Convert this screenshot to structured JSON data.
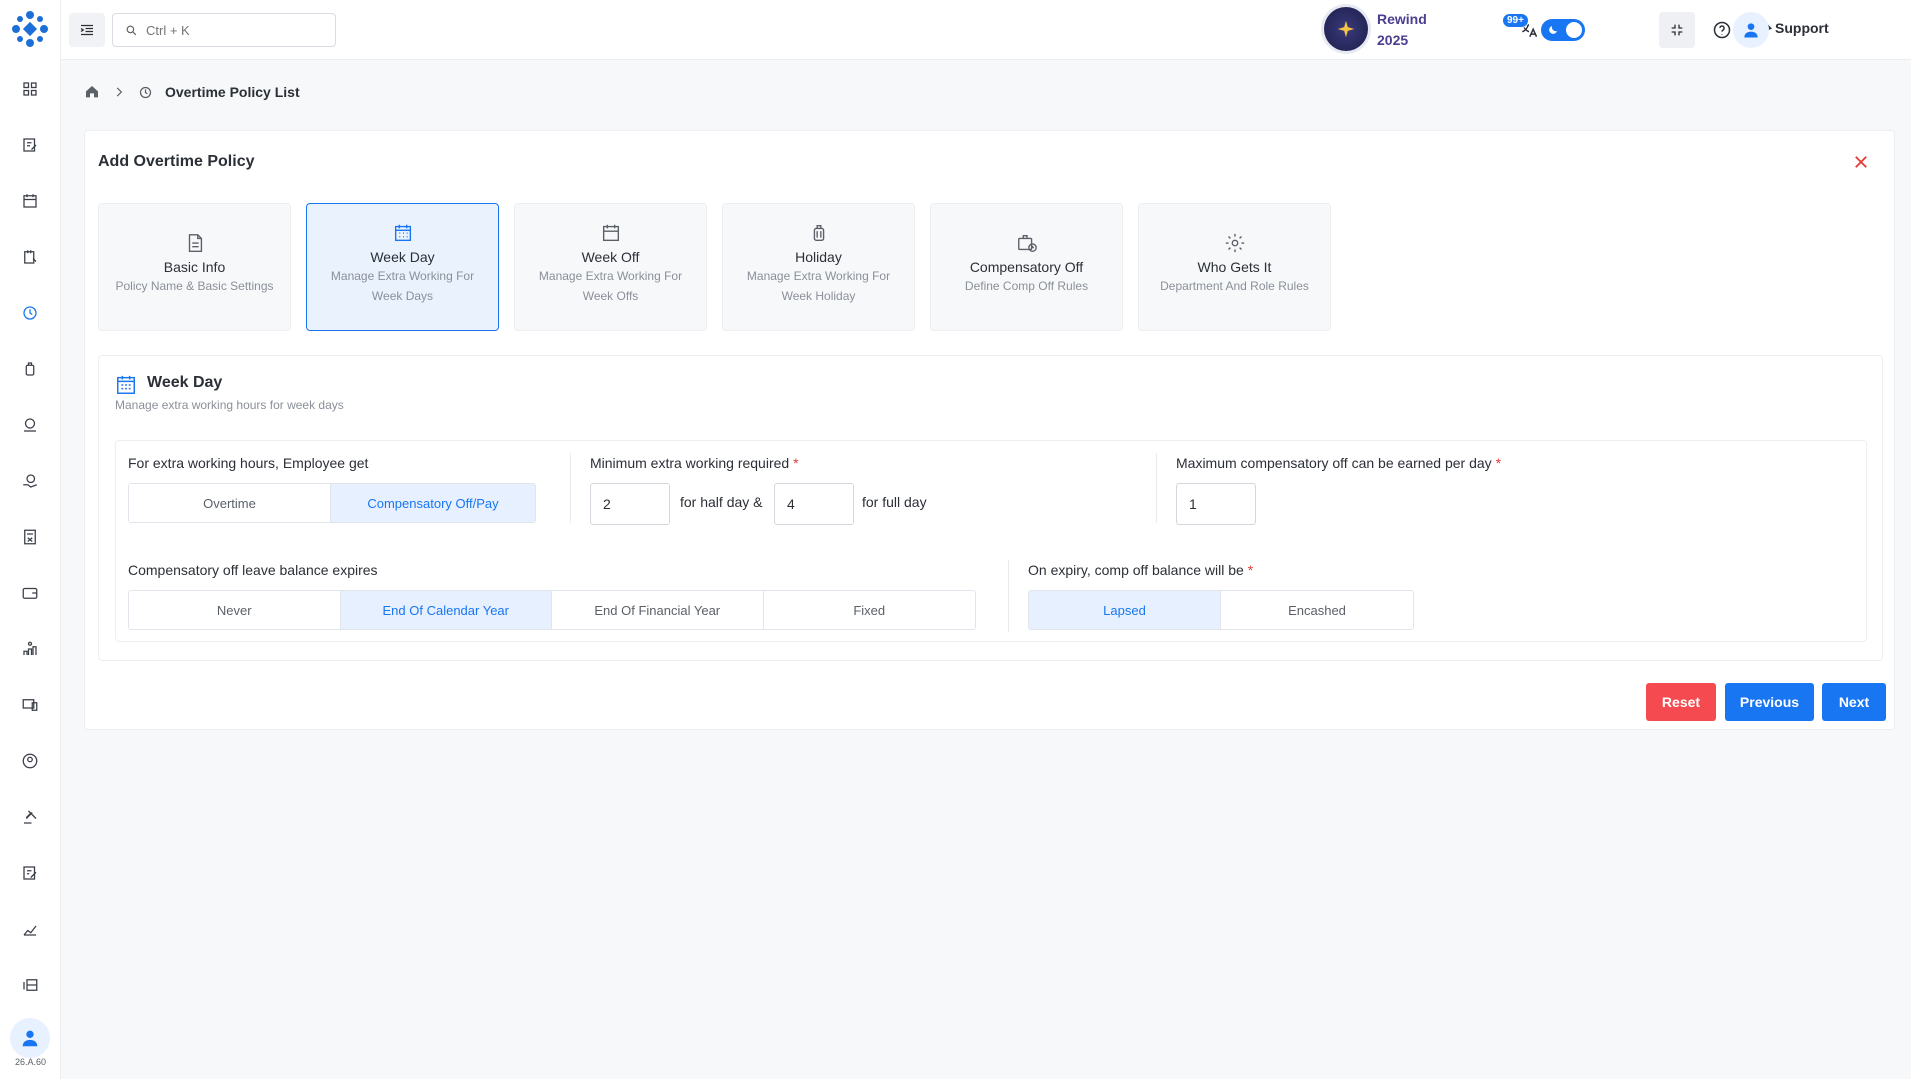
{
  "app": {
    "version": "26.A.60"
  },
  "search": {
    "placeholder": "Ctrl + K"
  },
  "header": {
    "rewind_line1": "Rewind",
    "rewind_line2": "2025",
    "notifications_badge": "99+",
    "user_name": "Support"
  },
  "breadcrumb": {
    "current": "Overtime Policy List"
  },
  "form": {
    "title": "Add Overtime Policy",
    "steps": [
      {
        "title": "Basic Info",
        "desc": "Policy Name & Basic Settings",
        "icon": "file-icon"
      },
      {
        "title": "Week Day",
        "desc": "Manage Extra Working For Week Days",
        "icon": "calendar-grid-icon"
      },
      {
        "title": "Week Off",
        "desc": "Manage Extra Working For Week Offs",
        "icon": "calendar-icon"
      },
      {
        "title": "Holiday",
        "desc": "Manage Extra Working For Week Holiday",
        "icon": "luggage-icon"
      },
      {
        "title": "Compensatory Off",
        "desc": "Define Comp Off Rules",
        "icon": "briefcase-clock-icon"
      },
      {
        "title": "Who Gets It",
        "desc": "Department And Role Rules",
        "icon": "gear-icon"
      }
    ],
    "active_step": 1,
    "section": {
      "title": "Week Day",
      "subtitle": "Manage extra working hours for week days",
      "employee_gets": {
        "label": "For extra working hours, Employee get",
        "options": [
          "Overtime",
          "Compensatory Off/Pay"
        ],
        "selected": "Compensatory Off/Pay"
      },
      "min_extra": {
        "label": "Minimum extra working required",
        "required": "*",
        "half_value": "2",
        "half_text": "for half day &",
        "full_value": "4",
        "full_text": "for full day"
      },
      "max_comp": {
        "label": "Maximum compensatory off can be earned per day",
        "required": "*",
        "value": "1"
      },
      "expires": {
        "label": "Compensatory off leave balance expires",
        "options": [
          "Never",
          "End Of Calendar Year",
          "End Of Financial Year",
          "Fixed"
        ],
        "selected": "End Of Calendar Year"
      },
      "on_expiry": {
        "label": "On expiry, comp off balance will be",
        "required": "*",
        "options": [
          "Lapsed",
          "Encashed"
        ],
        "selected": "Lapsed"
      }
    },
    "buttons": {
      "reset": "Reset",
      "previous": "Previous",
      "next": "Next"
    }
  },
  "colors": {
    "primary": "#1976f2",
    "danger": "#f54a4f",
    "rewind_text": "#4b3d8f"
  }
}
